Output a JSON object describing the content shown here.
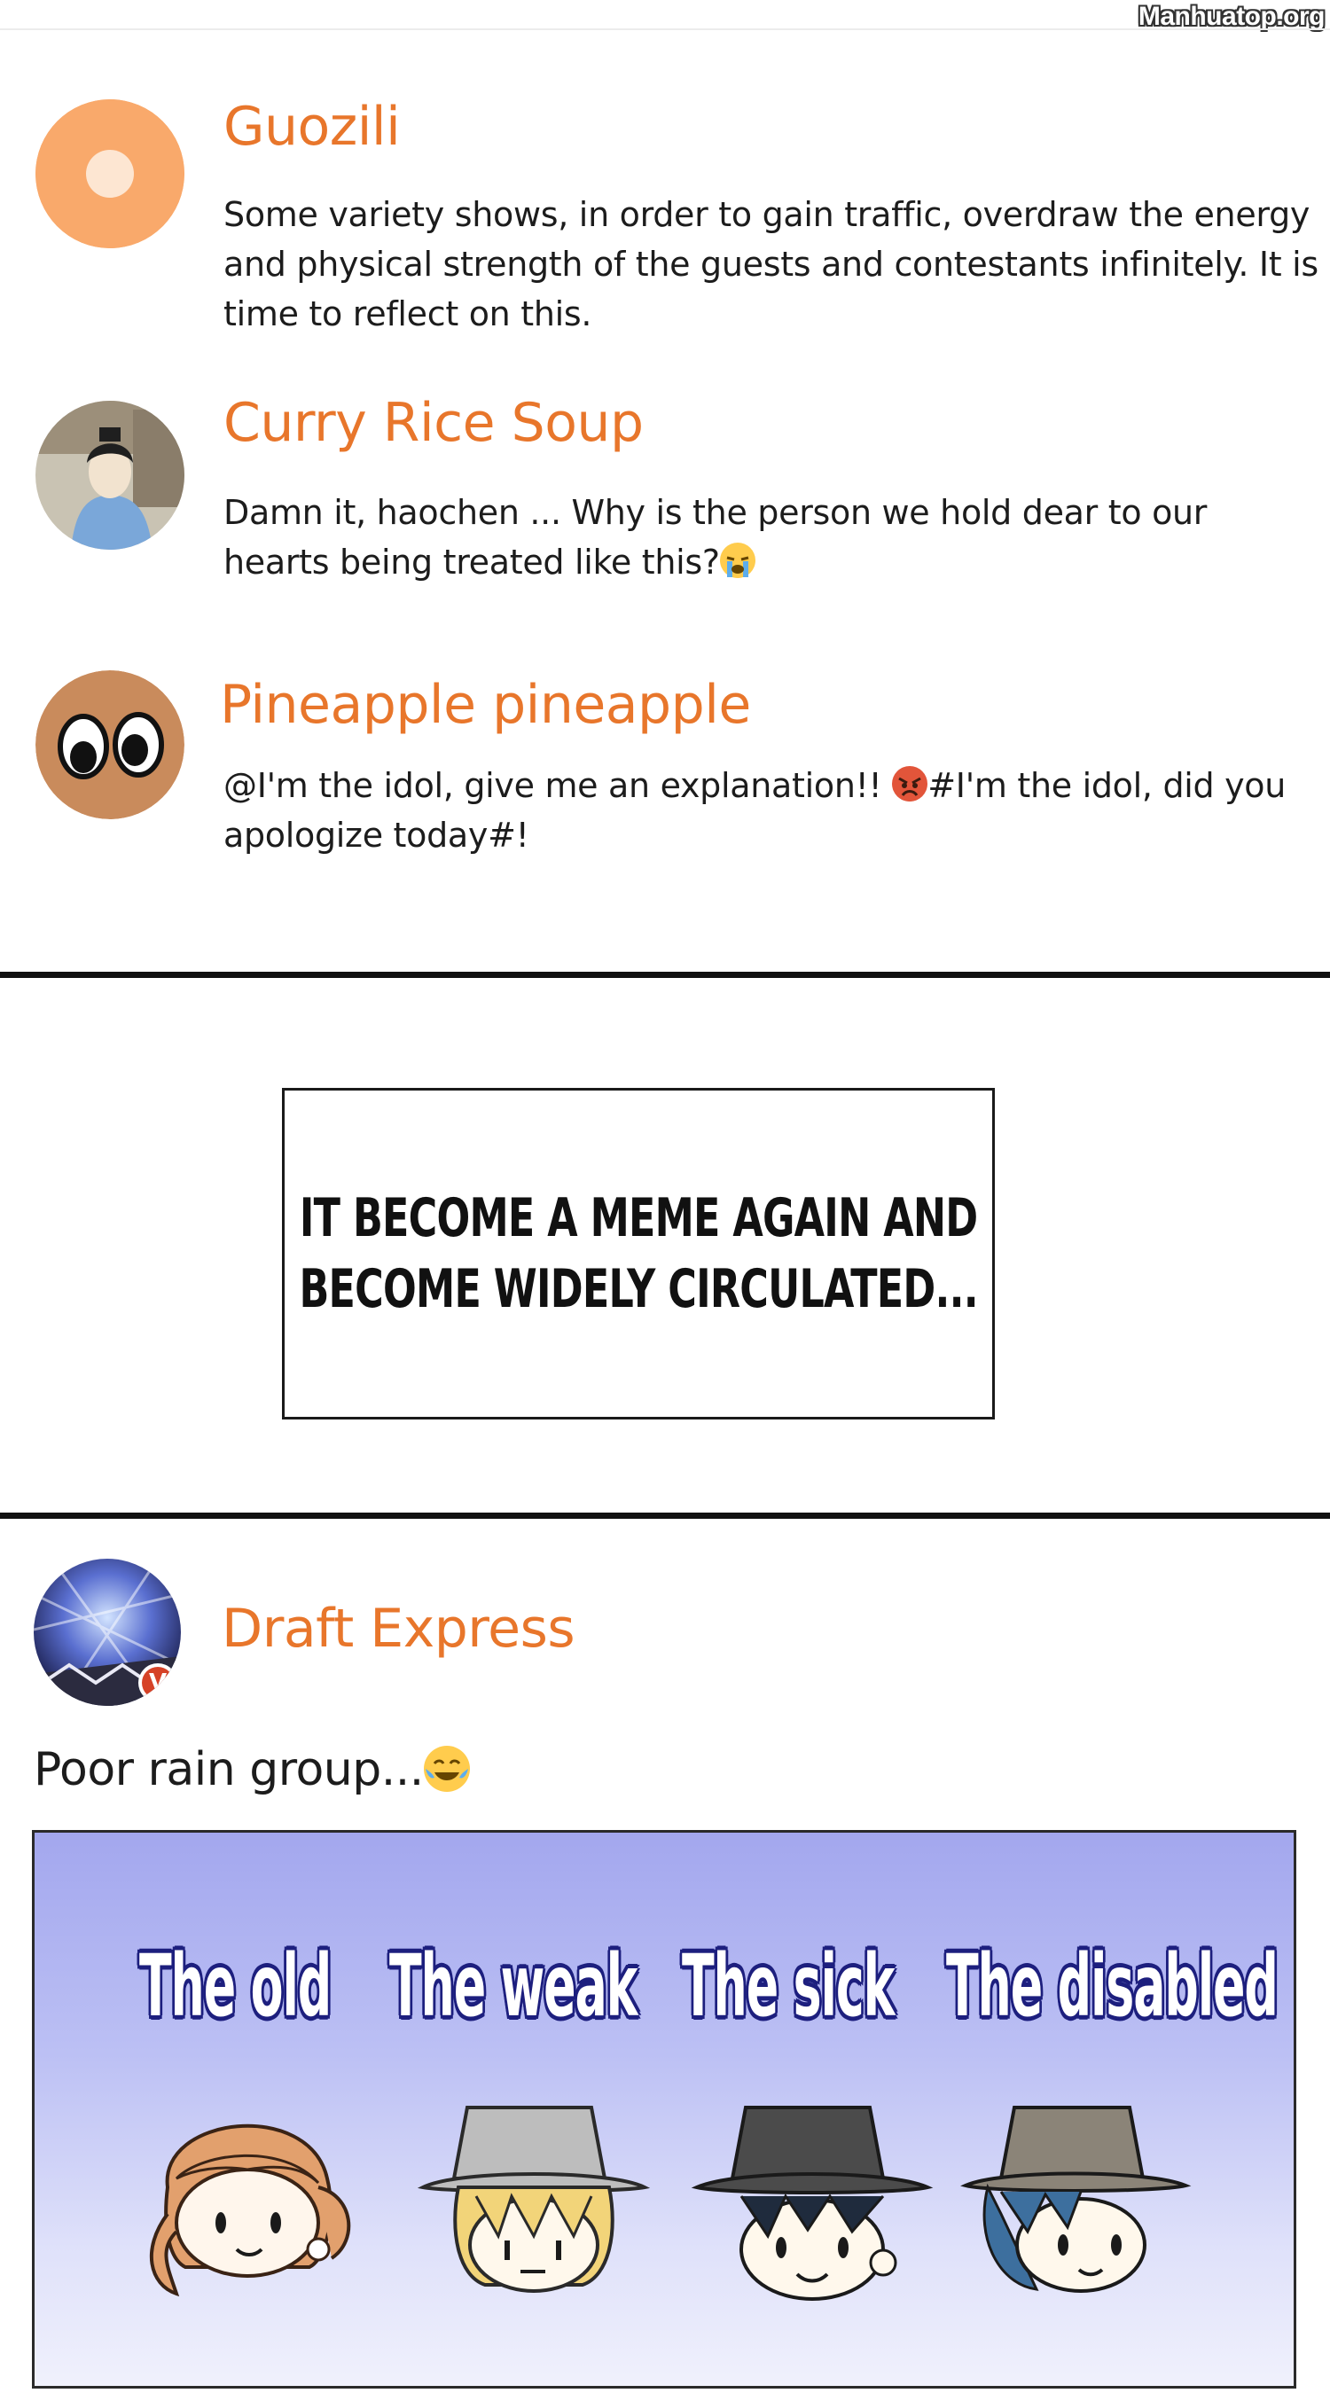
{
  "watermark": "Manhuatop.org",
  "comments": [
    {
      "username": "Guozili",
      "text": "Some variety shows, in order to gain traffic, overdraw the energy and physical strength of the guests and contestants infinitely. It is time to reflect on this."
    },
    {
      "username": "Curry Rice Soup",
      "text": "Damn it, haochen ... Why is the person we hold dear to our hearts being treated like this?",
      "emoji": "crying-face"
    },
    {
      "username": "Pineapple pineapple",
      "text_before": "@I'm the idol, give me an explanation!! ",
      "emoji": "angry-face",
      "text_after": "#I'm the idol, did you apologize today#!"
    }
  ],
  "caption": {
    "line1": "IT BECOME A MEME AGAIN AND",
    "line2": "BECOME WIDELY CIRCULATED..."
  },
  "post": {
    "username": "Draft Express",
    "verified_badge": "V",
    "text": "Poor rain group...",
    "emoji": "tears-of-joy",
    "panel_labels": [
      "The old",
      "The weak",
      "The sick",
      "The disabled"
    ]
  },
  "colors": {
    "username": "#e8762b",
    "panel_outline": "#1d1f7e",
    "divider": "#111111"
  }
}
